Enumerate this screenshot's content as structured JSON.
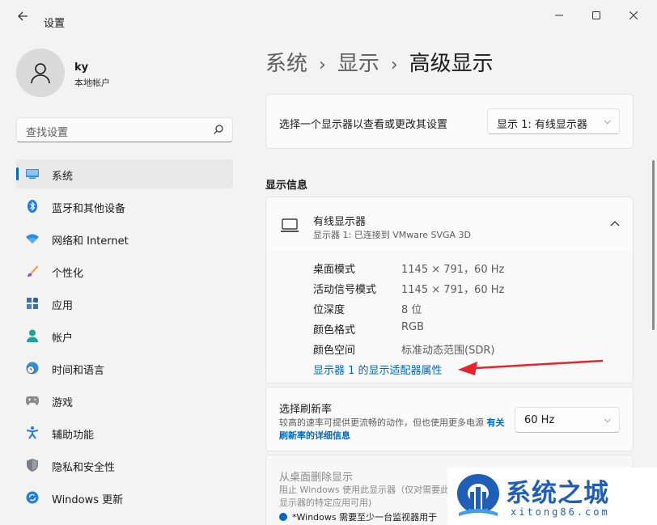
{
  "window": {
    "title": "设置",
    "back_icon": "arrow-left-icon",
    "minimize_icon": "minimize-icon",
    "maximize_icon": "maximize-icon",
    "close_icon": "close-icon"
  },
  "account": {
    "name": "ky",
    "type": "本地帐户"
  },
  "search": {
    "placeholder": "查找设置"
  },
  "sidebar": {
    "items": [
      {
        "label": "系统",
        "icon": "system-display-icon",
        "active": true
      },
      {
        "label": "蓝牙和其他设备",
        "icon": "bluetooth-icon"
      },
      {
        "label": "网络和 Internet",
        "icon": "wifi-icon"
      },
      {
        "label": "个性化",
        "icon": "paintbrush-icon"
      },
      {
        "label": "应用",
        "icon": "apps-icon"
      },
      {
        "label": "帐户",
        "icon": "person-icon"
      },
      {
        "label": "时间和语言",
        "icon": "clock-globe-icon"
      },
      {
        "label": "游戏",
        "icon": "gamepad-icon"
      },
      {
        "label": "辅助功能",
        "icon": "accessibility-icon"
      },
      {
        "label": "隐私和安全性",
        "icon": "shield-icon"
      },
      {
        "label": "Windows 更新",
        "icon": "update-icon"
      }
    ]
  },
  "breadcrumb": {
    "items": [
      "系统",
      "显示"
    ],
    "current": "高级显示"
  },
  "display_select": {
    "label": "选择一个显示器以查看或更改其设置",
    "value": "显示 1: 有线显示器"
  },
  "display_info": {
    "section_title": "显示信息",
    "monitor_title": "有线显示器",
    "monitor_sub": "显示器 1: 已连接到 VMware SVGA 3D",
    "properties": [
      {
        "key": "桌面模式",
        "value": "1145 × 791，60 Hz"
      },
      {
        "key": "活动信号模式",
        "value": "1145 × 791，60 Hz"
      },
      {
        "key": "位深度",
        "value": "8 位"
      },
      {
        "key": "颜色格式",
        "value": "RGB"
      },
      {
        "key": "颜色空间",
        "value": "标准动态范围(SDR)"
      }
    ],
    "adapter_link": "显示器 1 的显示适配器属性"
  },
  "refresh_rate": {
    "title": "选择刷新率",
    "desc": "较高的速率可提供更流畅的动作，但也使用更多电源",
    "link": "有关刷新率的详细信息",
    "value": "60 Hz"
  },
  "remove_display": {
    "title": "从桌面删除显示",
    "desc": "阻止 Windows 使用此显示器（仅对需要此显示器的特定应用可用)",
    "note": "*Windows 需要至少一台监视器用于"
  },
  "watermark": {
    "title": "系统之城",
    "url": "xitong86.com"
  },
  "colors": {
    "accent": "#0067c0",
    "arrow": "#e8232a",
    "watermark": "#1f5fb8"
  }
}
